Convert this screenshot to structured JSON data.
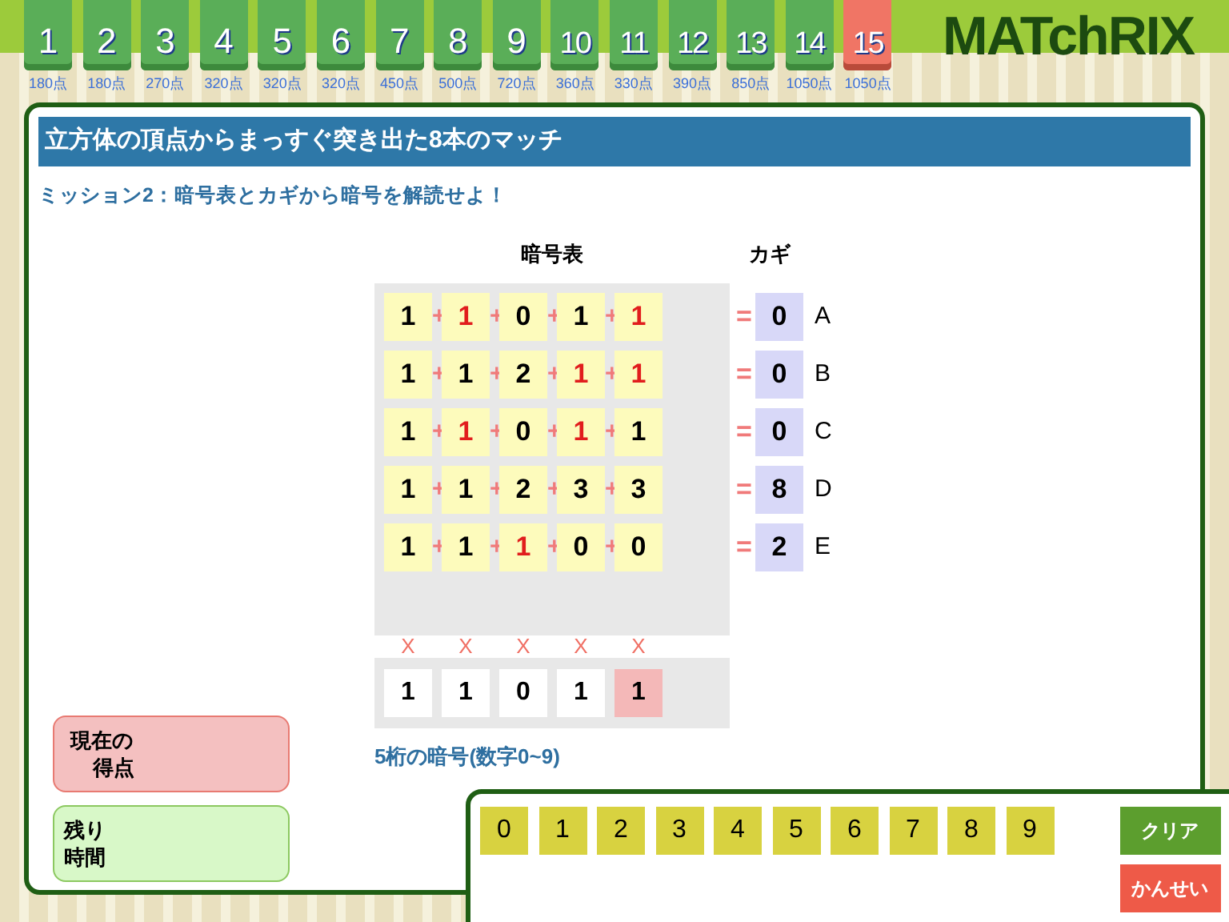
{
  "levels": [
    {
      "number": "1",
      "score": "180点",
      "selected": false
    },
    {
      "number": "2",
      "score": "180点",
      "selected": false
    },
    {
      "number": "3",
      "score": "270点",
      "selected": false
    },
    {
      "number": "4",
      "score": "320点",
      "selected": false
    },
    {
      "number": "5",
      "score": "320点",
      "selected": false
    },
    {
      "number": "6",
      "score": "320点",
      "selected": false
    },
    {
      "number": "7",
      "score": "450点",
      "selected": false
    },
    {
      "number": "8",
      "score": "500点",
      "selected": false
    },
    {
      "number": "9",
      "score": "720点",
      "selected": false
    },
    {
      "number": "10",
      "score": "360点",
      "selected": false
    },
    {
      "number": "11",
      "score": "330点",
      "selected": false
    },
    {
      "number": "12",
      "score": "390点",
      "selected": false
    },
    {
      "number": "13",
      "score": "850点",
      "selected": false
    },
    {
      "number": "14",
      "score": "1050点",
      "selected": false
    },
    {
      "number": "15",
      "score": "1050点",
      "selected": true
    }
  ],
  "logo": "MATchRIX",
  "title": "立方体の頂点からまっすぐ突き出た8本のマッチ",
  "mission": "ミッション2：暗号表とカギから暗号を解読せよ！",
  "table_heading": "暗号表",
  "key_heading": "カギ",
  "rows": [
    {
      "cells": [
        {
          "value": "1",
          "red": false
        },
        {
          "value": "1",
          "red": true
        },
        {
          "value": "0",
          "red": false
        },
        {
          "value": "1",
          "red": false
        },
        {
          "value": "1",
          "red": true
        }
      ],
      "operators": [
        "+",
        "+",
        "+",
        "+"
      ],
      "equals": "=",
      "key": "0",
      "letter": "A"
    },
    {
      "cells": [
        {
          "value": "1",
          "red": false
        },
        {
          "value": "1",
          "red": false
        },
        {
          "value": "2",
          "red": false
        },
        {
          "value": "1",
          "red": true
        },
        {
          "value": "1",
          "red": true
        }
      ],
      "operators": [
        "+",
        "+",
        "+",
        "+"
      ],
      "equals": "=",
      "key": "0",
      "letter": "B"
    },
    {
      "cells": [
        {
          "value": "1",
          "red": false
        },
        {
          "value": "1",
          "red": true
        },
        {
          "value": "0",
          "red": false
        },
        {
          "value": "1",
          "red": true
        },
        {
          "value": "1",
          "red": false
        }
      ],
      "operators": [
        "+",
        "+",
        "+",
        "+"
      ],
      "equals": "=",
      "key": "0",
      "letter": "C"
    },
    {
      "cells": [
        {
          "value": "1",
          "red": false
        },
        {
          "value": "1",
          "red": false
        },
        {
          "value": "2",
          "red": false
        },
        {
          "value": "3",
          "red": false
        },
        {
          "value": "3",
          "red": false
        }
      ],
      "operators": [
        "+",
        "+",
        "+",
        "+"
      ],
      "equals": "=",
      "key": "8",
      "letter": "D"
    },
    {
      "cells": [
        {
          "value": "1",
          "red": false
        },
        {
          "value": "1",
          "red": false
        },
        {
          "value": "1",
          "red": true
        },
        {
          "value": "0",
          "red": false
        },
        {
          "value": "0",
          "red": false
        }
      ],
      "operators": [
        "+",
        "+",
        "+",
        "+"
      ],
      "equals": "=",
      "key": "2",
      "letter": "E"
    }
  ],
  "answer": [
    {
      "mark": "X",
      "digit": "1",
      "selected": false
    },
    {
      "mark": "X",
      "digit": "1",
      "selected": false
    },
    {
      "mark": "X",
      "digit": "0",
      "selected": false
    },
    {
      "mark": "X",
      "digit": "1",
      "selected": false
    },
    {
      "mark": "X",
      "digit": "1",
      "selected": true
    }
  ],
  "answer_hint": "5桁の暗号(数字0~9)",
  "score_label": [
    "現在の",
    "得点"
  ],
  "time_label": [
    "残り",
    "時間"
  ],
  "keypad": [
    "0",
    "1",
    "2",
    "3",
    "4",
    "5",
    "6",
    "7",
    "8",
    "9"
  ],
  "clear_button": "クリア",
  "submit_button": "かんせい"
}
